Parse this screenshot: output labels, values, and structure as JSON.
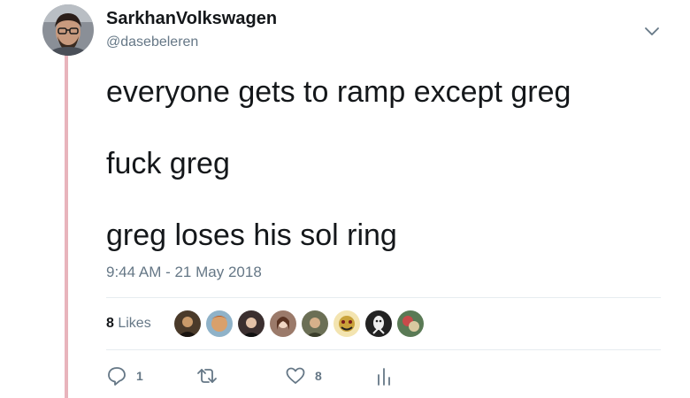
{
  "tweet": {
    "display_name": "SarkhanVolkswagen",
    "handle": "@dasebeleren",
    "lines": [
      "everyone gets to ramp except greg",
      "fuck greg",
      "greg loses his sol ring"
    ],
    "timestamp": "9:44 AM - 21 May 2018"
  },
  "likes": {
    "count": "8",
    "label": " Likes",
    "likers": [
      {
        "icon": "liker-avatar-1-icon",
        "color": "#4a3a2a"
      },
      {
        "icon": "liker-avatar-2-icon",
        "color": "#d9a06b"
      },
      {
        "icon": "liker-avatar-3-icon",
        "color": "#3b2f2f"
      },
      {
        "icon": "liker-avatar-4-icon",
        "color": "#9b7a6a"
      },
      {
        "icon": "liker-avatar-5-icon",
        "color": "#6b6f55"
      },
      {
        "icon": "liker-avatar-6-icon",
        "color": "#c9a23a"
      },
      {
        "icon": "liker-avatar-7-icon",
        "color": "#222222"
      },
      {
        "icon": "liker-avatar-8-icon",
        "color": "#5a7a55"
      }
    ]
  },
  "actions": {
    "reply_count": "1",
    "retweet_count": "",
    "like_count": "8"
  },
  "colors": {
    "thread_line": "#e8b4bc",
    "secondary_text": "#657786",
    "divider": "#e6ecf0"
  }
}
